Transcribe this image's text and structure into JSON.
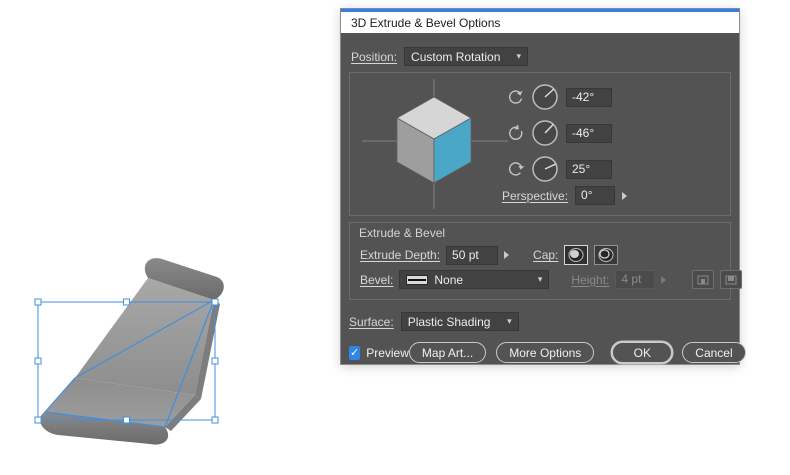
{
  "artboard": {
    "selection_color": "#3f8fe0",
    "object": "extruded-chair-shape"
  },
  "dialog": {
    "title": "3D Extrude & Bevel Options",
    "position_label": "Position:",
    "position_value": "Custom Rotation",
    "rotation": {
      "axes": [
        {
          "icon": "rotate-x-icon",
          "value": "-42°"
        },
        {
          "icon": "rotate-y-icon",
          "value": "-46°"
        },
        {
          "icon": "rotate-z-icon",
          "value": "25°"
        }
      ],
      "perspective_label": "Perspective:",
      "perspective_value": "0°",
      "cube_colors": {
        "top": "#d6d6d6",
        "left": "#9e9e9e",
        "right": "#4ba7c8"
      }
    },
    "extrude": {
      "section_title": "Extrude & Bevel",
      "depth_label": "Extrude Depth:",
      "depth_value": "50 pt",
      "cap_label": "Cap:",
      "bevel_label": "Bevel:",
      "bevel_value": "None",
      "height_label": "Height:",
      "height_value": "4 pt",
      "height_disabled": true
    },
    "surface_label": "Surface:",
    "surface_value": "Plastic Shading",
    "footer": {
      "preview": "Preview",
      "preview_checked": true,
      "check_glyph": "✓",
      "map_art": "Map Art...",
      "more_options": "More Options",
      "ok": "OK",
      "cancel": "Cancel"
    },
    "accent_blue": "#2e86e5"
  }
}
